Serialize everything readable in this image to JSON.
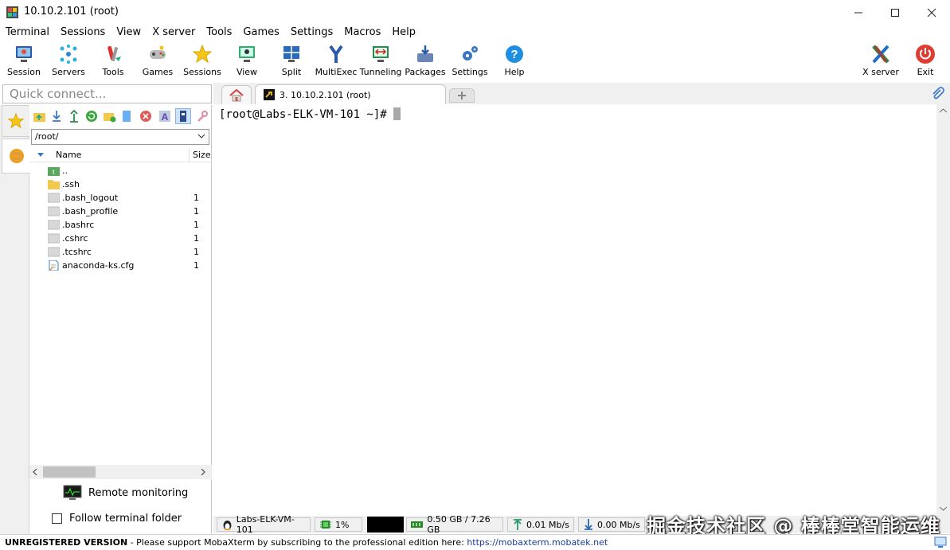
{
  "window": {
    "title": "10.10.2.101 (root)"
  },
  "menu": [
    "Terminal",
    "Sessions",
    "View",
    "X server",
    "Tools",
    "Games",
    "Settings",
    "Macros",
    "Help"
  ],
  "toolbar": {
    "session": "Session",
    "servers": "Servers",
    "tools": "Tools",
    "games": "Games",
    "sessions": "Sessions",
    "view": "View",
    "split": "Split",
    "multiexec": "MultiExec",
    "tunneling": "Tunneling",
    "packages": "Packages",
    "settings": "Settings",
    "help": "Help",
    "xserver": "X server",
    "exit": "Exit"
  },
  "quick_connect": {
    "placeholder": "Quick connect..."
  },
  "sftp": {
    "path": "/root/",
    "col_name": "Name",
    "col_size": "Size",
    "files": [
      {
        "name": "..",
        "size": "",
        "icon": "parent-folder-icon"
      },
      {
        "name": ".ssh",
        "size": "",
        "icon": "folder-icon"
      },
      {
        "name": ".bash_logout",
        "size": "1",
        "icon": "file-icon"
      },
      {
        "name": ".bash_profile",
        "size": "1",
        "icon": "file-icon"
      },
      {
        "name": ".bashrc",
        "size": "1",
        "icon": "file-icon"
      },
      {
        "name": ".cshrc",
        "size": "1",
        "icon": "file-icon"
      },
      {
        "name": ".tcshrc",
        "size": "1",
        "icon": "file-icon"
      },
      {
        "name": "anaconda-ks.cfg",
        "size": "1",
        "icon": "text-file-icon"
      }
    ],
    "remote_monitoring": "Remote monitoring",
    "follow_folder": "Follow terminal folder"
  },
  "tabs": {
    "active": "3. 10.10.2.101 (root)"
  },
  "terminal": {
    "prompt": "[root@Labs-ELK-VM-101 ~]# "
  },
  "status": {
    "host": "Labs-ELK-VM-101",
    "cpu": "1%",
    "memory": "0.50 GB / 7.26 GB",
    "upload": "0.01 Mb/s",
    "download": "0.00 Mb/s"
  },
  "watermark": "掘金技术社区 @ 棒棒堂智能运维",
  "bottom": {
    "label": "UNREGISTERED VERSION",
    "message": " -  Please support MobaXterm by subscribing to the professional edition here: ",
    "link": "https://mobaxterm.mobatek.net"
  },
  "colors": {
    "accent": "#3a78c6",
    "terminal_bg": "#ffffff",
    "exit_red": "#e03c31"
  }
}
